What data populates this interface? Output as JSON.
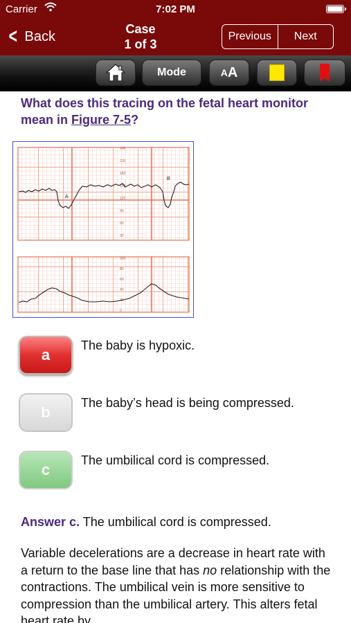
{
  "status": {
    "carrier": "Carrier",
    "time": "7:02 PM"
  },
  "nav": {
    "back_label": "Back",
    "title_line1": "Case",
    "title_line2": "1 of 3",
    "previous_label": "Previous",
    "next_label": "Next"
  },
  "toolbar": {
    "home_icon": "home-icon",
    "mode_label": "Mode",
    "font_label_small": "A",
    "font_label_big": "A",
    "note_icon": "yellow-note-icon",
    "bookmark_icon": "red-bookmark-icon"
  },
  "question": {
    "text_prefix": "What does this tracing on the fetal heart monitor mean in ",
    "figure_link": "Figure 7-5",
    "text_suffix": "?"
  },
  "figure": {
    "label_a": "A",
    "label_b": "B",
    "top_ticks": [
      "240",
      "210",
      "180",
      "150",
      "120",
      "90",
      "60",
      "30"
    ],
    "bottom_ticks": [
      "100",
      "80",
      "60",
      "40",
      "20",
      "0"
    ]
  },
  "choices": [
    {
      "letter": "a",
      "text": "The baby is hypoxic.",
      "color": "#e03030"
    },
    {
      "letter": "b",
      "text": "The baby’s head is being compressed.",
      "color": "#d8d8d8"
    },
    {
      "letter": "c",
      "text": "The umbilical cord is compressed.",
      "color": "#80c880"
    }
  ],
  "answer": {
    "lead": "Answer c.",
    "text": " The umbilical cord is compressed."
  },
  "explanation": {
    "part1": "Variable decelerations are a decrease in heart rate with a return to the base line that has ",
    "emphasis": "no",
    "part2": " relationship with the contractions. The umbilical vein is more sensitive to compression than the umbilical artery. This alters fetal heart rate by"
  },
  "colors": {
    "nav_bg": "#7a0a0a",
    "question_text": "#4b2a7e",
    "grid": "#f08a6a"
  }
}
